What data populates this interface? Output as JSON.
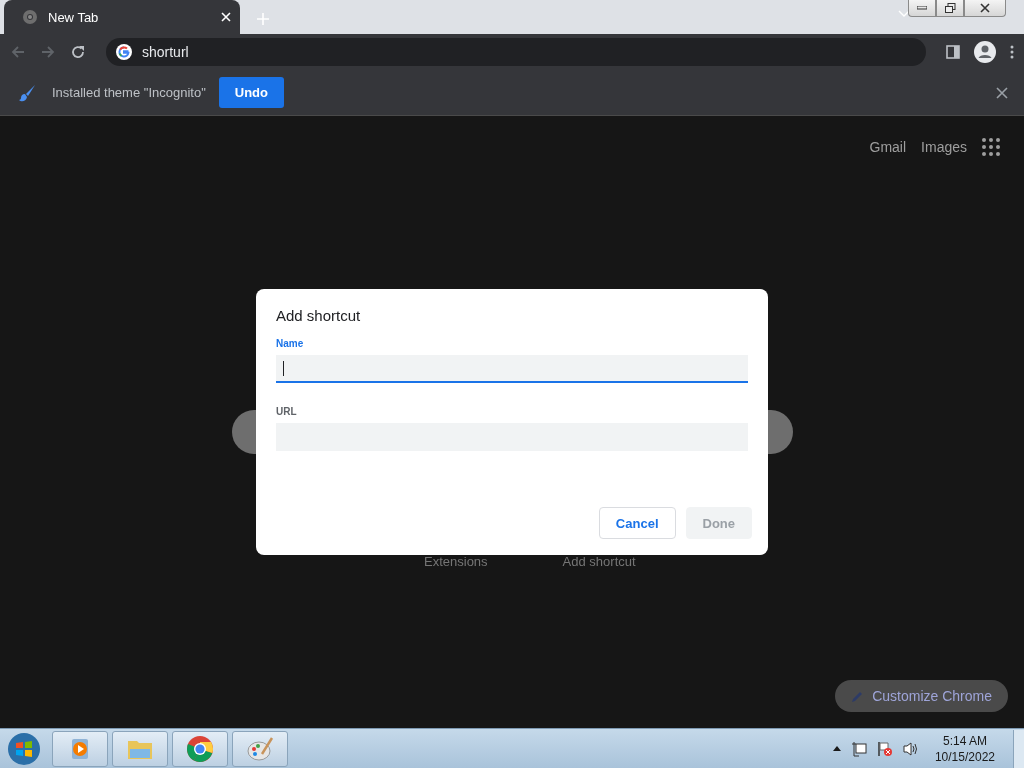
{
  "tab": {
    "title": "New Tab"
  },
  "address_bar": {
    "value": "shorturl"
  },
  "infobar": {
    "message": "Installed theme \"Incognito\"",
    "button": "Undo"
  },
  "header_links": [
    "Gmail",
    "Images"
  ],
  "shortcuts": [
    "Extensions",
    "Add shortcut"
  ],
  "customize_button": "Customize Chrome",
  "dialog": {
    "title": "Add shortcut",
    "fields": [
      {
        "label": "Name",
        "focused": true
      },
      {
        "label": "URL",
        "focused": false
      }
    ],
    "buttons": [
      {
        "label": "Cancel",
        "disabled": false
      },
      {
        "label": "Done",
        "disabled": true
      }
    ]
  },
  "clock": {
    "time": "5:14 AM",
    "date": "10/15/2022"
  }
}
